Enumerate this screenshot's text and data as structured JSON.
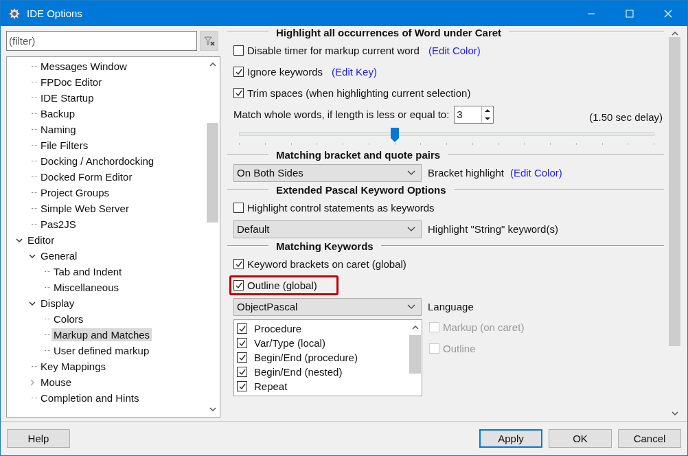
{
  "window": {
    "title": "IDE Options"
  },
  "filter": {
    "placeholder": "(filter)"
  },
  "tree": {
    "items": [
      {
        "children": [
          {
            "label": "Messages Window",
            "selected": false
          },
          {
            "label": "FPDoc Editor",
            "selected": false
          },
          {
            "label": "IDE Startup",
            "selected": false
          },
          {
            "label": "Backup",
            "selected": false
          },
          {
            "label": "Naming",
            "selected": false
          },
          {
            "label": "File Filters",
            "selected": false
          },
          {
            "label": "Docking / Anchordocking",
            "selected": false
          },
          {
            "label": "Docked Form Editor",
            "selected": false
          },
          {
            "label": "Project Groups",
            "selected": false
          },
          {
            "label": "Simple Web Server",
            "selected": false
          },
          {
            "label": "Pas2JS",
            "selected": false
          }
        ]
      },
      {
        "label": "Editor",
        "selected": false,
        "expanded": true,
        "children": [
          {
            "label": "General",
            "selected": false,
            "expanded": true,
            "children": [
              {
                "label": "Tab and Indent",
                "selected": false
              },
              {
                "label": "Miscellaneous",
                "selected": false
              }
            ]
          },
          {
            "label": "Display",
            "selected": false,
            "expanded": true,
            "children": [
              {
                "label": "Colors",
                "selected": false
              },
              {
                "label": "Markup and Matches",
                "selected": true
              },
              {
                "label": "User defined markup",
                "selected": false
              }
            ]
          },
          {
            "label": "Key Mappings",
            "selected": false
          },
          {
            "label": "Mouse",
            "selected": false,
            "expanded": false
          },
          {
            "label": "Completion and Hints",
            "selected": false
          }
        ]
      }
    ]
  },
  "sections": [
    {
      "title": "Highlight all occurrences of Word under Caret",
      "rows": [
        {
          "kind": "checkbox",
          "label": "Disable timer for markup current word",
          "checked": false,
          "link": "(Edit Color)"
        },
        {
          "kind": "checkbox",
          "label": "Ignore keywords",
          "checked": true,
          "link": "(Edit Key)"
        },
        {
          "kind": "checkbox",
          "label": "Trim spaces (when highlighting current selection)",
          "checked": true
        },
        {
          "kind": "spin",
          "label": "Match whole words, if length is less or equal to:",
          "value": "3",
          "note": "(1.50 sec delay)"
        },
        {
          "kind": "slider",
          "level": 0.375
        }
      ]
    },
    {
      "title": "Matching bracket and quote pairs",
      "rows": [
        {
          "kind": "combo",
          "option": "On Both Sides",
          "label": "Bracket highlight",
          "link": "(Edit Color)"
        }
      ]
    },
    {
      "title": "Extended Pascal Keyword Options",
      "rows": [
        {
          "kind": "checkbox",
          "label": "Highlight control statements as keywords",
          "checked": false
        },
        {
          "kind": "combo",
          "option": "Default",
          "label": "Highlight \"String\" keyword(s)"
        }
      ]
    },
    {
      "title": "Matching Keywords",
      "rows": [
        {
          "kind": "checkbox",
          "label": "Keyword brackets on caret (global)",
          "checked": true
        },
        {
          "kind": "checkbox",
          "label": "Outline (global)",
          "checked": true,
          "highlighted": true
        },
        {
          "kind": "combo",
          "option": "ObjectPascal",
          "label": "Language"
        },
        {
          "kind": "keywords",
          "items": [
            {
              "label": "Procedure",
              "checked": true
            },
            {
              "label": "Var/Type (local)",
              "checked": true
            },
            {
              "label": "Begin/End (procedure)",
              "checked": true
            },
            {
              "label": "Begin/End (nested)",
              "checked": true
            },
            {
              "label": "Repeat",
              "checked": true
            }
          ],
          "options": [
            {
              "label": "Markup (on caret)",
              "checked": false,
              "disabled": true
            },
            {
              "label": "Outline",
              "checked": false,
              "disabled": true
            }
          ]
        }
      ]
    }
  ],
  "buttons": [
    {
      "label": "Help",
      "default": false
    },
    {
      "label": "Apply",
      "default": true
    },
    {
      "label": "OK",
      "default": false
    },
    {
      "label": "Cancel",
      "default": false
    }
  ]
}
